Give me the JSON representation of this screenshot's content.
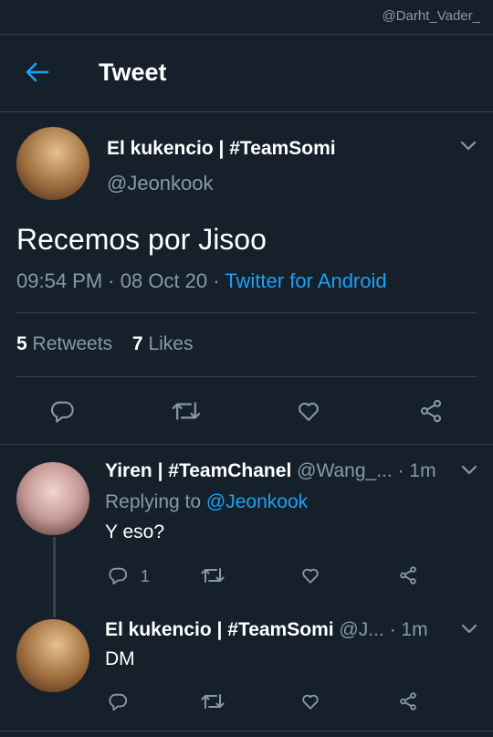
{
  "watermark": "@Darht_Vader_",
  "header": {
    "title": "Tweet"
  },
  "main_tweet": {
    "author_name": "El kukencio | #TeamSomi",
    "handle": "@Jeonkook",
    "text": "Recemos por Jisoo",
    "time": "09:54 PM",
    "date": "08 Oct 20",
    "source": "Twitter for Android",
    "retweets": {
      "count": "5",
      "label": "Retweets"
    },
    "likes": {
      "count": "7",
      "label": "Likes"
    }
  },
  "replies": [
    {
      "author_name": "Yiren | #TeamChanel",
      "handle": "@Wang_...",
      "time": "· 1m",
      "replying_label": "Replying to",
      "replying_handle": "@Jeonkook",
      "text": "Y eso?",
      "reply_count": "1"
    },
    {
      "author_name": "El kukencio | #TeamSomi",
      "handle": "@J...",
      "time": "· 1m",
      "text": "DM"
    }
  ],
  "colors": {
    "background": "#15202b",
    "accent": "#1da1f2",
    "muted": "#8899a6",
    "divider": "#38444d"
  },
  "icons": [
    "back-arrow-icon",
    "chevron-down-icon",
    "reply-icon",
    "retweet-icon",
    "like-icon",
    "share-icon"
  ]
}
